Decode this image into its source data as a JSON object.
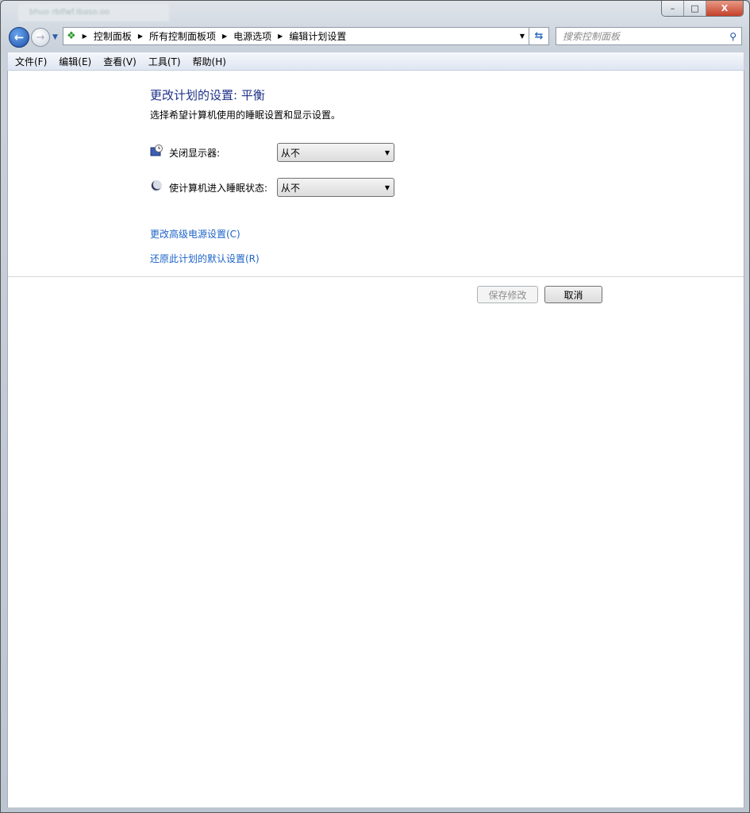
{
  "window": {
    "tab_title": "bhuo rblfwf.lbaso.oo",
    "controls": {
      "minimize": "–",
      "maximize": "□",
      "close": "X"
    }
  },
  "address": {
    "breadcrumbs": [
      "控制面板",
      "所有控制面板项",
      "电源选项",
      "编辑计划设置"
    ]
  },
  "search": {
    "placeholder": "搜索控制面板"
  },
  "menu": [
    "文件(F)",
    "编辑(E)",
    "查看(V)",
    "工具(T)",
    "帮助(H)"
  ],
  "main": {
    "title": "更改计划的设置: 平衡",
    "subtitle": "选择希望计算机使用的睡眠设置和显示设置。",
    "settings": [
      {
        "label": "关闭显示器:",
        "value": "从不",
        "icon": "monitor-clock-icon"
      },
      {
        "label": "使计算机进入睡眠状态:",
        "value": "从不",
        "icon": "moon-icon"
      }
    ],
    "links": [
      "更改高级电源设置(C)",
      "还原此计划的默认设置(R)"
    ],
    "save_label": "保存修改",
    "cancel_label": "取消"
  }
}
